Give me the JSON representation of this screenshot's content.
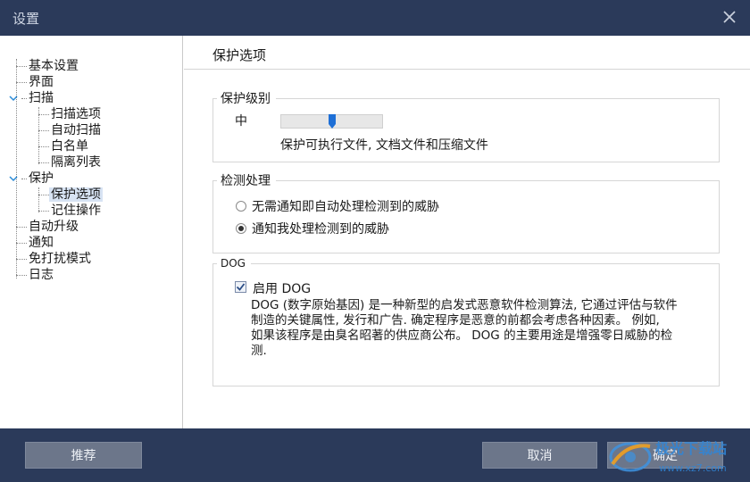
{
  "window": {
    "title": "设置"
  },
  "sidebar": {
    "items": [
      {
        "label": "基本设置"
      },
      {
        "label": "界面"
      },
      {
        "label": "扫描"
      },
      {
        "label": "扫描选项"
      },
      {
        "label": "自动扫描"
      },
      {
        "label": "白名单"
      },
      {
        "label": "隔离列表"
      },
      {
        "label": "保护"
      },
      {
        "label": "保护选项"
      },
      {
        "label": "记住操作"
      },
      {
        "label": "自动升级"
      },
      {
        "label": "通知"
      },
      {
        "label": "免打扰模式"
      },
      {
        "label": "日志"
      }
    ],
    "selected": "保护选项"
  },
  "main": {
    "heading": "保护选项",
    "protection_level": {
      "title": "保护级别",
      "level_label": "中",
      "level_fraction": 0.5,
      "description": "保护可执行文件, 文档文件和压缩文件"
    },
    "detection": {
      "title": "检测处理",
      "options": [
        {
          "label": "无需通知即自动处理检测到的威胁",
          "selected": false
        },
        {
          "label": "通知我处理检测到的威胁",
          "selected": true
        }
      ]
    },
    "dog": {
      "title": "DOG",
      "enable_label": "启用 DOG",
      "enabled": true,
      "description_lines": [
        "DOG (数字原始基因) 是一种新型的启发式恶意软件检测算法, 它通过评估与软件",
        "制造的关键属性, 发行和广告. 确定程序是恶意的前都会考虑各种因素。 例如,",
        "如果该程序是由臭名昭著的供应商公布。 DOG 的主要用途是增强零日威胁的检",
        "测."
      ]
    }
  },
  "footer": {
    "recommend_label": "推荐",
    "cancel_label": "取消",
    "ok_label": "确定"
  },
  "watermark": {
    "text": "极光下载站",
    "url": "www.xz7.com"
  },
  "colors": {
    "titlebar": "#2b3a5a",
    "footer": "#2b3a5a",
    "button": "#6c768a",
    "accent": "#1e6fd6",
    "selection": "#d7e3f3"
  }
}
